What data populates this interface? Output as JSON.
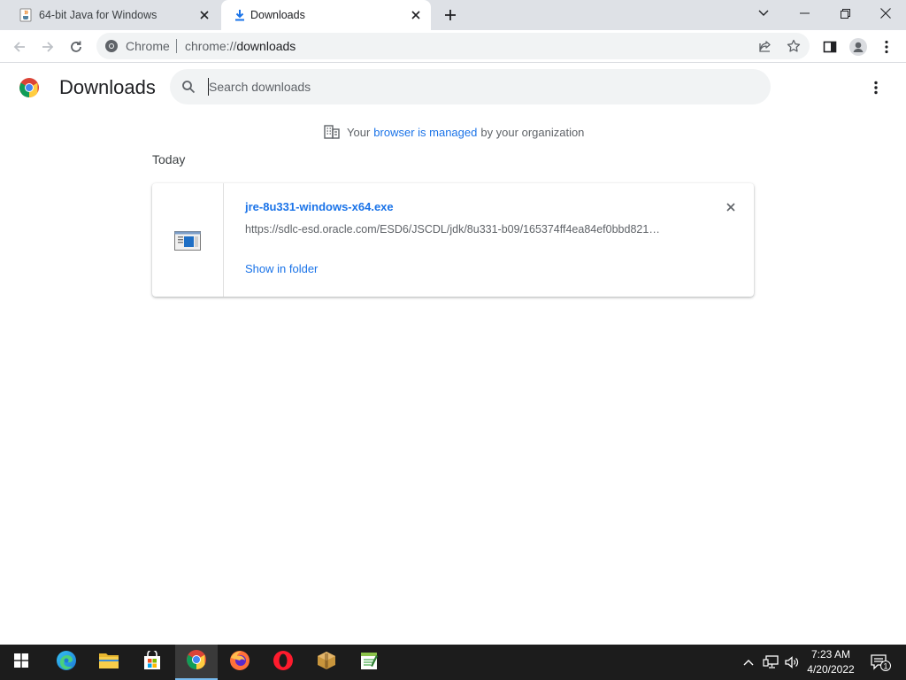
{
  "browser": {
    "tabs": [
      {
        "title": "64-bit Java for Windows",
        "icon": "java-cup-icon",
        "active": false
      },
      {
        "title": "Downloads",
        "icon": "download-arrow-icon",
        "active": true
      }
    ],
    "omnibox": {
      "chip": "Chrome",
      "url_scheme": "chrome://",
      "url_host": "downloads"
    }
  },
  "downloads": {
    "title": "Downloads",
    "search_placeholder": "Search downloads",
    "managed": {
      "prefix": "Your",
      "link": "browser is managed",
      "suffix": "by your organization"
    },
    "section": "Today",
    "items": [
      {
        "file_name": "jre-8u331-windows-x64.exe",
        "url": "https://sdlc-esd.oracle.com/ESD6/JSCDL/jdk/8u331-b09/165374ff4ea84ef0bbd821…",
        "action": "Show in folder"
      }
    ]
  },
  "taskbar": {
    "apps": [
      "start",
      "edge",
      "file-explorer",
      "store",
      "chrome",
      "firefox",
      "opera",
      "archive-app",
      "notepad-app"
    ],
    "time": "7:23 AM",
    "date": "4/20/2022",
    "notification_count": "1"
  },
  "colors": {
    "accent": "#1a73e8",
    "tabstrip": "#dee1e6",
    "taskbar": "#1c1c1c"
  }
}
